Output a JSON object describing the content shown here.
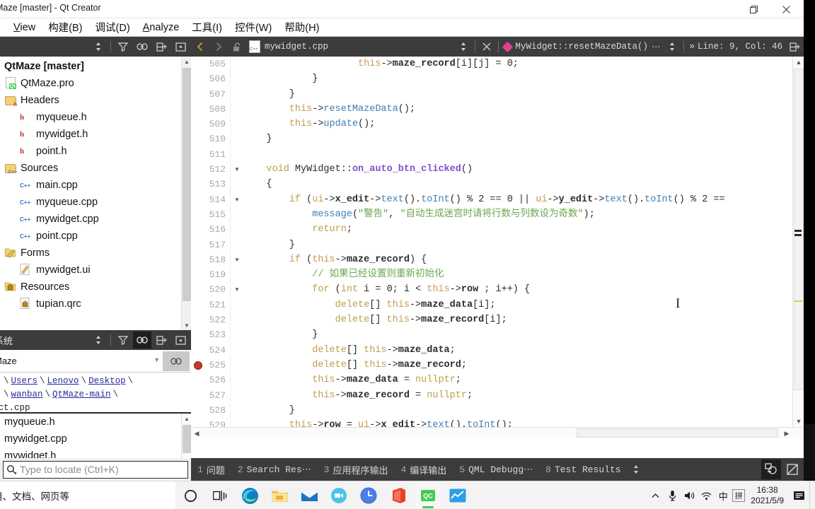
{
  "window": {
    "title": "Maze [master] - Qt Creator",
    "restore_icon": "restore-icon",
    "close_icon": "close-icon"
  },
  "menubar": {
    "items": [
      {
        "label": "View",
        "accel": "V"
      },
      {
        "label": "构建(B)",
        "accel": "B"
      },
      {
        "label": "调试(D)",
        "accel": "D"
      },
      {
        "label": "Analyze",
        "accel": "A"
      },
      {
        "label": "工具(I)",
        "accel": "I"
      },
      {
        "label": "控件(W)",
        "accel": "W"
      },
      {
        "label": "帮助(H)",
        "accel": "H"
      }
    ]
  },
  "project_pane": {
    "title": "",
    "tools": [
      "sort-icon",
      "filter-icon",
      "link-icon",
      "split-icon",
      "collapse-icon"
    ],
    "tree": [
      {
        "label": "QtMaze [master]",
        "indent": 0,
        "icon": "project-icon",
        "bold": true
      },
      {
        "label": "QtMaze.pro",
        "indent": 1,
        "icon": "qt-pro-file-icon"
      },
      {
        "label": "Headers",
        "indent": 1,
        "icon": "folder-headers-icon"
      },
      {
        "label": "myqueue.h",
        "indent": 2,
        "icon": "header-file-icon"
      },
      {
        "label": "mywidget.h",
        "indent": 2,
        "icon": "header-file-icon"
      },
      {
        "label": "point.h",
        "indent": 2,
        "icon": "header-file-icon"
      },
      {
        "label": "Sources",
        "indent": 1,
        "icon": "folder-sources-icon"
      },
      {
        "label": "main.cpp",
        "indent": 2,
        "icon": "cpp-file-icon"
      },
      {
        "label": "myqueue.cpp",
        "indent": 2,
        "icon": "cpp-file-icon"
      },
      {
        "label": "mywidget.cpp",
        "indent": 2,
        "icon": "cpp-file-icon"
      },
      {
        "label": "point.cpp",
        "indent": 2,
        "icon": "cpp-file-icon"
      },
      {
        "label": "Forms",
        "indent": 1,
        "icon": "folder-forms-icon"
      },
      {
        "label": "mywidget.ui",
        "indent": 2,
        "icon": "ui-file-icon"
      },
      {
        "label": "Resources",
        "indent": 1,
        "icon": "folder-resources-icon"
      },
      {
        "label": "tupian.qrc",
        "indent": 2,
        "icon": "qrc-file-icon"
      }
    ]
  },
  "filesystem_pane": {
    "title": "系统",
    "tools": [
      "sort-icon",
      "filter-icon",
      "link-icon",
      "split-icon",
      "menu-icon"
    ],
    "combo_value": "Maze",
    "breadcrumb": {
      "line1": [
        "Users",
        "Lenovo",
        "Desktop"
      ],
      "line2": [
        "wanban",
        "QtMaze-main"
      ],
      "tail": "ect.cpp"
    },
    "files": [
      "myqueue.h",
      "mywidget.cpp",
      "mywidget.h"
    ]
  },
  "locator": {
    "icon": "search-icon",
    "placeholder": "Type to locate (Ctrl+K)",
    "value": ""
  },
  "editor_toolbar": {
    "back_icon": "chevron-left-icon",
    "forward_icon": "chevron-right-icon",
    "lock_icon": "unlocked-icon",
    "file_icon": "cpp-file-icon",
    "filename": "mywidget.cpp",
    "split_icon": "updown-arrows-icon",
    "close_icon": "close-icon",
    "symbol_icon": "method-diamond-icon",
    "symbol": "MyWidget::resetMazeData()",
    "symbol_ellipsis": "⋯",
    "position": "Line: 9, Col: 46",
    "position_prefix": "»",
    "split_editor_icon": "split-editor-icon"
  },
  "code": {
    "first_line": 505,
    "breakpoint_line": 525,
    "fold_lines": [
      512,
      514,
      518,
      520
    ],
    "lines": [
      {
        "n": 505,
        "tokens": [
          {
            "t": "                    ",
            "c": "op"
          },
          {
            "t": "this",
            "c": "ths"
          },
          {
            "t": "->",
            "c": "op"
          },
          {
            "t": "maze_record",
            "c": "mem"
          },
          {
            "t": "[i][j] = ",
            "c": "op"
          },
          {
            "t": "0",
            "c": "num"
          },
          {
            "t": ";",
            "c": "op"
          }
        ]
      },
      {
        "n": 506,
        "tokens": [
          {
            "t": "            }",
            "c": "op"
          }
        ]
      },
      {
        "n": 507,
        "tokens": [
          {
            "t": "        }",
            "c": "op"
          }
        ]
      },
      {
        "n": 508,
        "tokens": [
          {
            "t": "        ",
            "c": "op"
          },
          {
            "t": "this",
            "c": "ths"
          },
          {
            "t": "->",
            "c": "op"
          },
          {
            "t": "resetMazeData",
            "c": "call"
          },
          {
            "t": "();",
            "c": "op"
          }
        ]
      },
      {
        "n": 509,
        "tokens": [
          {
            "t": "        ",
            "c": "op"
          },
          {
            "t": "this",
            "c": "ths"
          },
          {
            "t": "->",
            "c": "op"
          },
          {
            "t": "update",
            "c": "call"
          },
          {
            "t": "();",
            "c": "op"
          }
        ]
      },
      {
        "n": 510,
        "tokens": [
          {
            "t": "    }",
            "c": "op"
          }
        ]
      },
      {
        "n": 511,
        "tokens": [
          {
            "t": "",
            "c": "op"
          }
        ]
      },
      {
        "n": 512,
        "tokens": [
          {
            "t": "    ",
            "c": "op"
          },
          {
            "t": "void",
            "c": "kw"
          },
          {
            "t": " ",
            "c": "op"
          },
          {
            "t": "MyWidget",
            "c": "cls"
          },
          {
            "t": "::",
            "c": "op"
          },
          {
            "t": "on_auto_btn_clicked",
            "c": "fn"
          },
          {
            "t": "()",
            "c": "op"
          }
        ]
      },
      {
        "n": 513,
        "tokens": [
          {
            "t": "    {",
            "c": "op"
          }
        ]
      },
      {
        "n": 514,
        "tokens": [
          {
            "t": "        ",
            "c": "op"
          },
          {
            "t": "if",
            "c": "kw"
          },
          {
            "t": " (",
            "c": "op"
          },
          {
            "t": "ui",
            "c": "ths"
          },
          {
            "t": "->",
            "c": "op"
          },
          {
            "t": "x_edit",
            "c": "mem"
          },
          {
            "t": "->",
            "c": "op"
          },
          {
            "t": "text",
            "c": "call"
          },
          {
            "t": "().",
            "c": "op"
          },
          {
            "t": "toInt",
            "c": "call"
          },
          {
            "t": "() % ",
            "c": "op"
          },
          {
            "t": "2",
            "c": "num"
          },
          {
            "t": " == ",
            "c": "op"
          },
          {
            "t": "0",
            "c": "num"
          },
          {
            "t": " || ",
            "c": "op"
          },
          {
            "t": "ui",
            "c": "ths"
          },
          {
            "t": "->",
            "c": "op"
          },
          {
            "t": "y_edit",
            "c": "mem"
          },
          {
            "t": "->",
            "c": "op"
          },
          {
            "t": "text",
            "c": "call"
          },
          {
            "t": "().",
            "c": "op"
          },
          {
            "t": "toInt",
            "c": "call"
          },
          {
            "t": "() % ",
            "c": "op"
          },
          {
            "t": "2",
            "c": "num"
          },
          {
            "t": " ==",
            "c": "op"
          }
        ]
      },
      {
        "n": 515,
        "tokens": [
          {
            "t": "            ",
            "c": "op"
          },
          {
            "t": "message",
            "c": "call"
          },
          {
            "t": "(",
            "c": "op"
          },
          {
            "t": "\"警告\"",
            "c": "str"
          },
          {
            "t": ", ",
            "c": "op"
          },
          {
            "t": "\"自动生成迷宫时请将行数与列数设为奇数\"",
            "c": "str"
          },
          {
            "t": ");",
            "c": "op"
          }
        ]
      },
      {
        "n": 516,
        "tokens": [
          {
            "t": "            ",
            "c": "op"
          },
          {
            "t": "return",
            "c": "kw"
          },
          {
            "t": ";",
            "c": "op"
          }
        ]
      },
      {
        "n": 517,
        "tokens": [
          {
            "t": "        }",
            "c": "op"
          }
        ]
      },
      {
        "n": 518,
        "tokens": [
          {
            "t": "        ",
            "c": "op"
          },
          {
            "t": "if",
            "c": "kw"
          },
          {
            "t": " (",
            "c": "op"
          },
          {
            "t": "this",
            "c": "ths"
          },
          {
            "t": "->",
            "c": "op"
          },
          {
            "t": "maze_record",
            "c": "mem"
          },
          {
            "t": ") {",
            "c": "op"
          }
        ]
      },
      {
        "n": 519,
        "tokens": [
          {
            "t": "            ",
            "c": "op"
          },
          {
            "t": "// 如果已经设置则重新初始化",
            "c": "cmt"
          }
        ]
      },
      {
        "n": 520,
        "tokens": [
          {
            "t": "            ",
            "c": "op"
          },
          {
            "t": "for",
            "c": "kw"
          },
          {
            "t": " (",
            "c": "op"
          },
          {
            "t": "int",
            "c": "kw"
          },
          {
            "t": " i = ",
            "c": "op"
          },
          {
            "t": "0",
            "c": "num"
          },
          {
            "t": "; i < ",
            "c": "op"
          },
          {
            "t": "this",
            "c": "ths"
          },
          {
            "t": "->",
            "c": "op"
          },
          {
            "t": "row",
            "c": "mem"
          },
          {
            "t": " ; i++) {",
            "c": "op"
          }
        ]
      },
      {
        "n": 521,
        "tokens": [
          {
            "t": "                ",
            "c": "op"
          },
          {
            "t": "delete",
            "c": "kw"
          },
          {
            "t": "[] ",
            "c": "op"
          },
          {
            "t": "this",
            "c": "ths"
          },
          {
            "t": "->",
            "c": "op"
          },
          {
            "t": "maze_data",
            "c": "mem"
          },
          {
            "t": "[i];",
            "c": "op"
          }
        ]
      },
      {
        "n": 522,
        "tokens": [
          {
            "t": "                ",
            "c": "op"
          },
          {
            "t": "delete",
            "c": "kw"
          },
          {
            "t": "[] ",
            "c": "op"
          },
          {
            "t": "this",
            "c": "ths"
          },
          {
            "t": "->",
            "c": "op"
          },
          {
            "t": "maze_record",
            "c": "mem"
          },
          {
            "t": "[i];",
            "c": "op"
          }
        ]
      },
      {
        "n": 523,
        "tokens": [
          {
            "t": "            }",
            "c": "op"
          }
        ]
      },
      {
        "n": 524,
        "tokens": [
          {
            "t": "            ",
            "c": "op"
          },
          {
            "t": "delete",
            "c": "kw"
          },
          {
            "t": "[] ",
            "c": "op"
          },
          {
            "t": "this",
            "c": "ths"
          },
          {
            "t": "->",
            "c": "op"
          },
          {
            "t": "maze_data",
            "c": "mem"
          },
          {
            "t": ";",
            "c": "op"
          }
        ]
      },
      {
        "n": 525,
        "tokens": [
          {
            "t": "            ",
            "c": "op"
          },
          {
            "t": "delete",
            "c": "kw"
          },
          {
            "t": "[] ",
            "c": "op"
          },
          {
            "t": "this",
            "c": "ths"
          },
          {
            "t": "->",
            "c": "op"
          },
          {
            "t": "maze_record",
            "c": "mem"
          },
          {
            "t": ";",
            "c": "op"
          }
        ]
      },
      {
        "n": 526,
        "tokens": [
          {
            "t": "            ",
            "c": "op"
          },
          {
            "t": "this",
            "c": "ths"
          },
          {
            "t": "->",
            "c": "op"
          },
          {
            "t": "maze_data",
            "c": "mem"
          },
          {
            "t": " = ",
            "c": "op"
          },
          {
            "t": "nullptr",
            "c": "kw"
          },
          {
            "t": ";",
            "c": "op"
          }
        ]
      },
      {
        "n": 527,
        "tokens": [
          {
            "t": "            ",
            "c": "op"
          },
          {
            "t": "this",
            "c": "ths"
          },
          {
            "t": "->",
            "c": "op"
          },
          {
            "t": "maze_record",
            "c": "mem"
          },
          {
            "t": " = ",
            "c": "op"
          },
          {
            "t": "nullptr",
            "c": "kw"
          },
          {
            "t": ";",
            "c": "op"
          }
        ]
      },
      {
        "n": 528,
        "tokens": [
          {
            "t": "        }",
            "c": "op"
          }
        ]
      },
      {
        "n": 529,
        "tokens": [
          {
            "t": "        ",
            "c": "op"
          },
          {
            "t": "this",
            "c": "ths"
          },
          {
            "t": "->",
            "c": "op"
          },
          {
            "t": "row",
            "c": "mem"
          },
          {
            "t": " = ",
            "c": "op"
          },
          {
            "t": "ui",
            "c": "ths"
          },
          {
            "t": "->",
            "c": "op"
          },
          {
            "t": "x_edit",
            "c": "mem"
          },
          {
            "t": "->",
            "c": "op"
          },
          {
            "t": "text",
            "c": "call"
          },
          {
            "t": "().",
            "c": "op"
          },
          {
            "t": "toInt",
            "c": "call"
          },
          {
            "t": "();",
            "c": "op"
          }
        ]
      }
    ]
  },
  "output_bar": {
    "tabs": [
      {
        "num": "1",
        "label": "问题"
      },
      {
        "num": "2",
        "label": "Search Res⋯"
      },
      {
        "num": "3",
        "label": "应用程序输出"
      },
      {
        "num": "4",
        "label": "编译输出"
      },
      {
        "num": "5",
        "label": "QML Debugg⋯"
      },
      {
        "num": "8",
        "label": "Test Results"
      }
    ],
    "sort_icon": "updown-arrows-icon",
    "buttons": [
      "minimize-output-icon",
      "maximize-output-icon"
    ]
  },
  "taskbar": {
    "search_text": "用、文档、网页等",
    "search_icon": "search-icon",
    "items": [
      {
        "name": "cortana-icon"
      },
      {
        "name": "task-view-icon"
      },
      {
        "name": "edge-icon"
      },
      {
        "name": "file-explorer-icon"
      },
      {
        "name": "mail-icon"
      },
      {
        "name": "zoom-icon"
      },
      {
        "name": "clock-app-icon"
      },
      {
        "name": "office-icon"
      },
      {
        "name": "qt-creator-icon"
      }
    ],
    "tray": [
      "chevron-up-icon",
      "microphone-icon",
      "volume-icon",
      "network-icon"
    ],
    "ime": "中",
    "ime2": "拼",
    "time": "16:38",
    "date": "2021/5/9",
    "notification_icon": "notification-icon"
  },
  "colors": {
    "toolbar_dark": "#3c3c3c",
    "accent_pink": "#e0418f",
    "string_green": "#6aa84f",
    "keyword_gold": "#b8a14a",
    "breakpoint_red": "#c0392b"
  }
}
